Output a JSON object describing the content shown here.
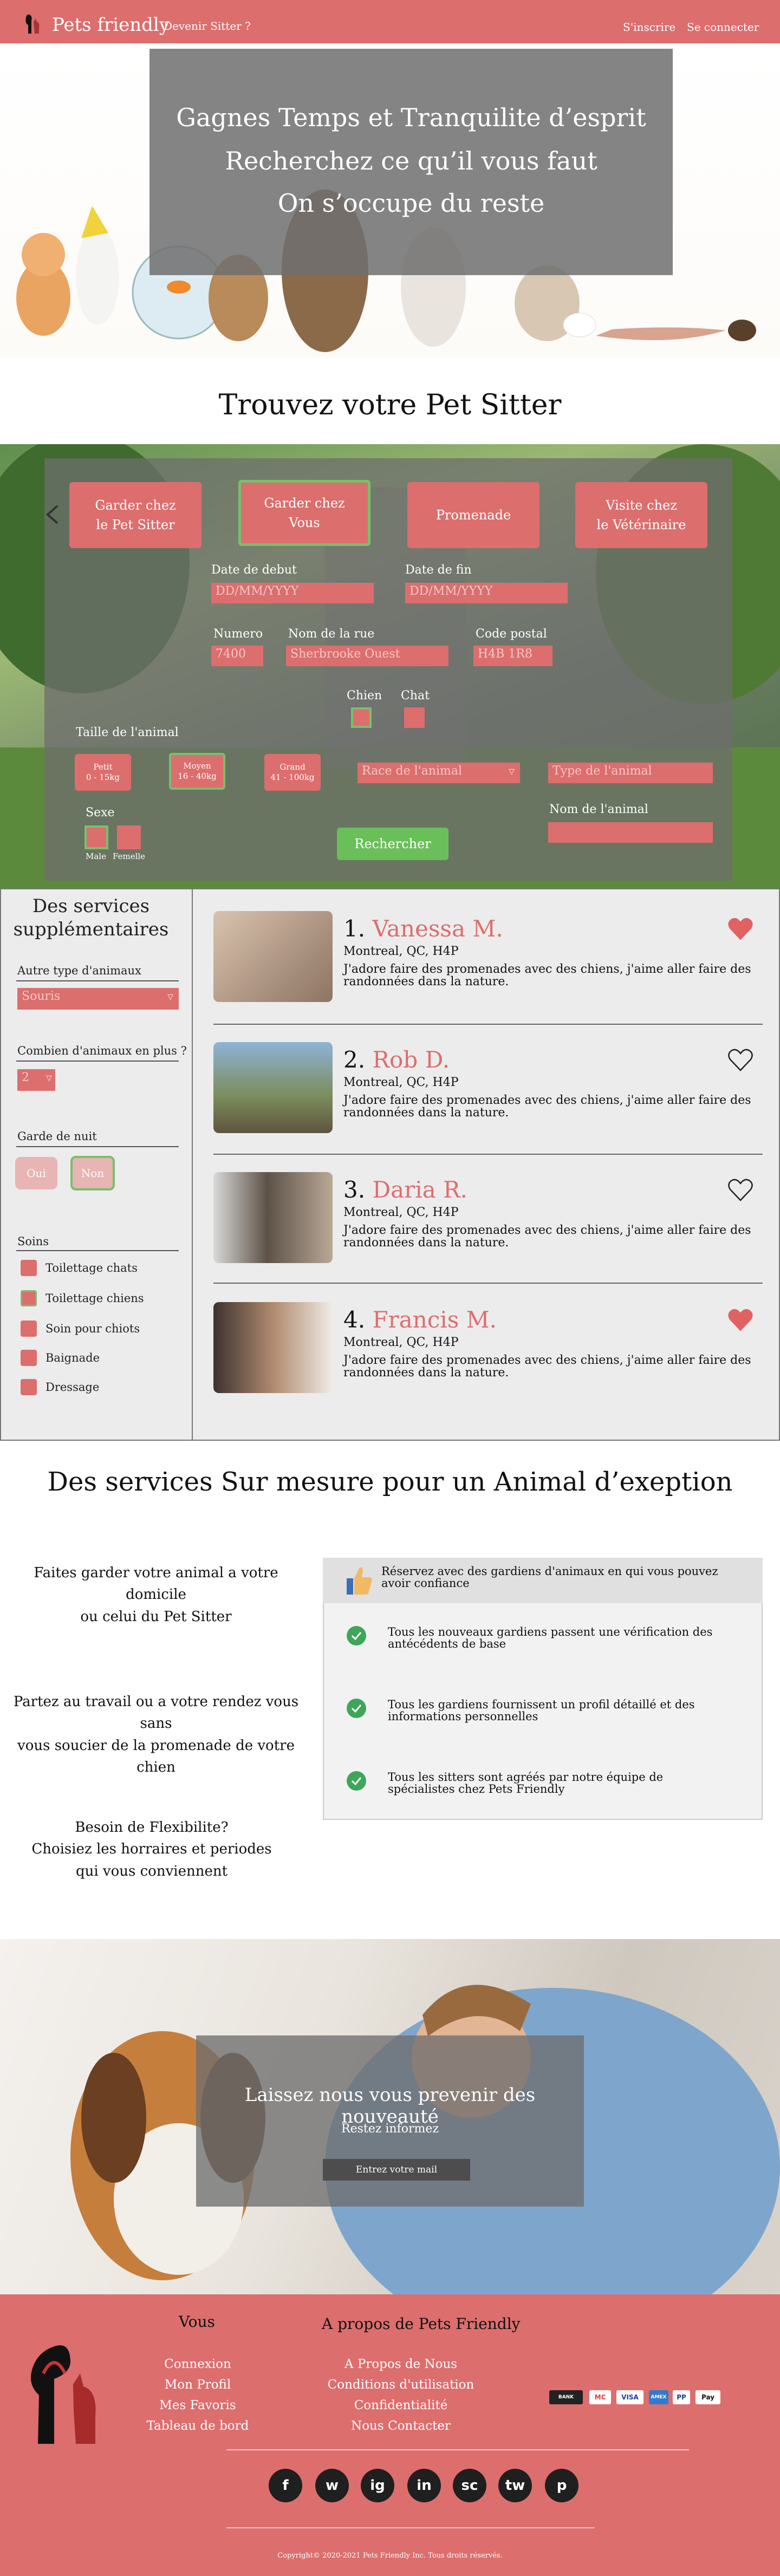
{
  "header": {
    "brand": "Pets friendly",
    "become_sitter": "Devenir Sitter ?",
    "signup": "S'inscrire",
    "login": "Se connecter"
  },
  "hero": {
    "lines": [
      "Gagnes Temps et Tranquilite d’esprit",
      "Recherchez ce qu’il vous faut",
      "On s’occupe du reste"
    ]
  },
  "search_title": "Trouvez votre Pet Sitter",
  "search": {
    "services": [
      {
        "line1": "Garder chez",
        "line2": "le Pet Sitter"
      },
      {
        "line1": "Garder chez",
        "line2": "Vous"
      },
      {
        "line1": "Promenade",
        "line2": ""
      },
      {
        "line1": "Visite chez",
        "line2": "le Vétérinaire"
      }
    ],
    "start_label": "Date de debut",
    "start_placeholder": "DD/MM/YYYY",
    "end_label": "Date de fin",
    "end_placeholder": "DD/MM/YYYY",
    "number_label": "Numero",
    "number_value": "7400",
    "street_label": "Nom de la rue",
    "street_value": "Sherbrooke Ouest",
    "postal_label": "Code postal",
    "postal_value": "H4B 1R8",
    "dog_label": "Chien",
    "cat_label": "Chat",
    "size_label": "Taille de l'animal",
    "sizes": [
      {
        "line1": "Petit",
        "line2": "0 - 15kg"
      },
      {
        "line1": "Moyen",
        "line2": "16 - 40kg"
      },
      {
        "line1": "Grand",
        "line2": "41 - 100kg"
      }
    ],
    "breed_placeholder": "Race de l'animal",
    "type_placeholder": "Type de l'animal",
    "animal_name_label": "Nom de l'animal",
    "sex_label": "Sexe",
    "male_label": "Male",
    "female_label": "Femelle",
    "search_button": "Rechercher"
  },
  "filters": {
    "title_line1": "Des services",
    "title_line2": "supplémentaires",
    "other_type_label": "Autre type d'animaux",
    "other_type_value": "Souris",
    "count_label": "Combien d'animaux en plus ?",
    "count_value": "2",
    "night_label": "Garde de nuit",
    "yes_label": "Oui",
    "no_label": "Non",
    "care_label": "Soins",
    "care_items": [
      {
        "label": "Toilettage chats",
        "checked": false
      },
      {
        "label": "Toilettage chiens",
        "checked": true
      },
      {
        "label": "Soin pour chiots",
        "checked": false
      },
      {
        "label": "Baignade",
        "checked": false
      },
      {
        "label": "Dressage",
        "checked": false
      }
    ]
  },
  "sitters": [
    {
      "rank": "1.",
      "name": "Vanessa M.",
      "location": "Montreal, QC, H4P",
      "description": "J'adore faire des promenades avec des chiens, j'aime aller faire des randonnées dans la nature.",
      "favorite": true
    },
    {
      "rank": "2.",
      "name": "Rob D.",
      "location": "Montreal, QC, H4P",
      "description": "J'adore faire des promenades avec des chiens, j'aime aller faire des randonnées dans la nature.",
      "favorite": false
    },
    {
      "rank": "3.",
      "name": "Daria R.",
      "location": "Montreal, QC, H4P",
      "description": "J'adore faire des promenades avec des chiens, j'aime aller faire des randonnées dans la nature.",
      "favorite": false
    },
    {
      "rank": "4.",
      "name": "Francis M.",
      "location": "Montreal, QC, H4P",
      "description": "J'adore faire des promenades avec des chiens, j'aime aller faire des randonnées dans la nature.",
      "favorite": true
    }
  ],
  "services_title": "Des services Sur mesure pour un Animal d’exeption",
  "services_left": {
    "p1_line1": "Faites garder votre animal a votre domicile",
    "p1_line2": "ou celui du Pet Sitter",
    "p2_line1": "Partez au travail ou a votre rendez vous sans",
    "p2_line2": "vous soucier de la promenade de votre chien",
    "p3_line1": "Besoin de Flexibilite?",
    "p3_line2": "Choisiez les horraires et periodes",
    "p3_line3": "qui vous conviennent"
  },
  "trust": {
    "header": "Réservez avec des gardiens d'animaux en qui vous pouvez avoir confiance",
    "items": [
      "Tous les nouveaux gardiens passent une vérification des antécédents de base",
      "Tous les gardiens fournissent un profil détaillé et des informations personnelles",
      "Tous les sitters sont agréés par notre équipe de spécialistes chez Pets Friendly"
    ]
  },
  "newsletter": {
    "title": "Laissez nous vous prevenir des nouveauté",
    "subtitle": "Restez informez",
    "button": "Entrez votre mail"
  },
  "footer": {
    "col1_title": "Vous",
    "col1_links": [
      "Connexion",
      "Mon Profil",
      "Mes Favoris",
      "Tableau de bord"
    ],
    "col2_title": "A propos de Pets Friendly",
    "col2_links": [
      "A Propos de Nous",
      "Conditions d'utilisation",
      "Confidentialité",
      "Nous Contacter"
    ],
    "payments": [
      "BANK",
      "MC",
      "VISA",
      "AMEX",
      "PP",
      "Pay"
    ],
    "socials": [
      "f",
      "w",
      "ig",
      "in",
      "sc",
      "tw",
      "p"
    ],
    "copyright": "Copyright© 2020-2021 Pets Friendly Inc. Tous droits réservés."
  },
  "colors": {
    "brand_pink": "#dc6e6e",
    "selected_green": "#78c06b",
    "search_green": "#6abf5a",
    "panel_gray": "#6e6e6e"
  }
}
